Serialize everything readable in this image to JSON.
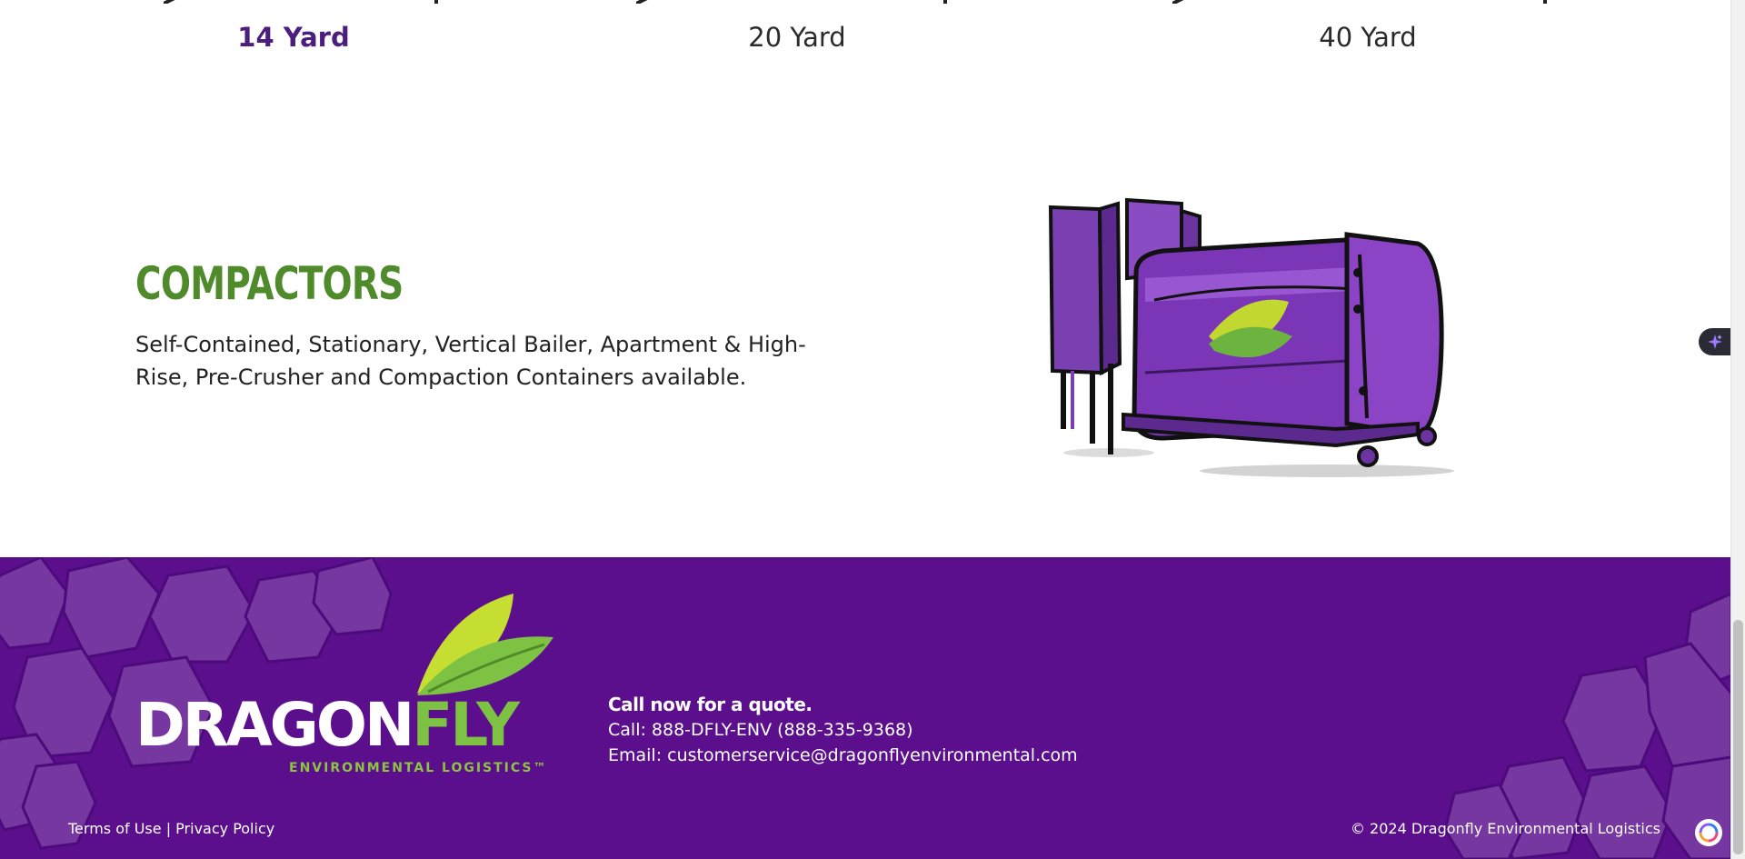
{
  "sizes": {
    "items": [
      {
        "label": "14 Yard",
        "active": true
      },
      {
        "label": "20 Yard",
        "active": false
      },
      {
        "label": "40 Yard",
        "active": false
      }
    ]
  },
  "compactors": {
    "title": "COMPACTORS",
    "description": "Self-Contained, Stationary, Vertical Bailer, Apartment & High-Rise, Pre-Crusher and Compaction Containers available.",
    "illustration_icon": "compactor-illustration"
  },
  "footer": {
    "logo": {
      "word_a": "DRAGON",
      "word_b": "FLY",
      "subtitle": "ENVIRONMENTAL LOGISTICS™"
    },
    "contact": {
      "heading": "Call now for a quote.",
      "phone": "Call: 888-DFLY-ENV (888-335-9368)",
      "email": "Email: customerservice@dragonflyenvironmental.com"
    },
    "links": {
      "terms": "Terms of Use",
      "separator": " | ",
      "privacy": "Privacy Policy"
    },
    "copyright": "© 2024 Dragonfly Environmental Logistics"
  },
  "colors": {
    "brand_purple": "#5b0f8d",
    "brand_green": "#4f8a2b",
    "accent_green": "#7dc242",
    "active_size": "#4a1d7e"
  }
}
